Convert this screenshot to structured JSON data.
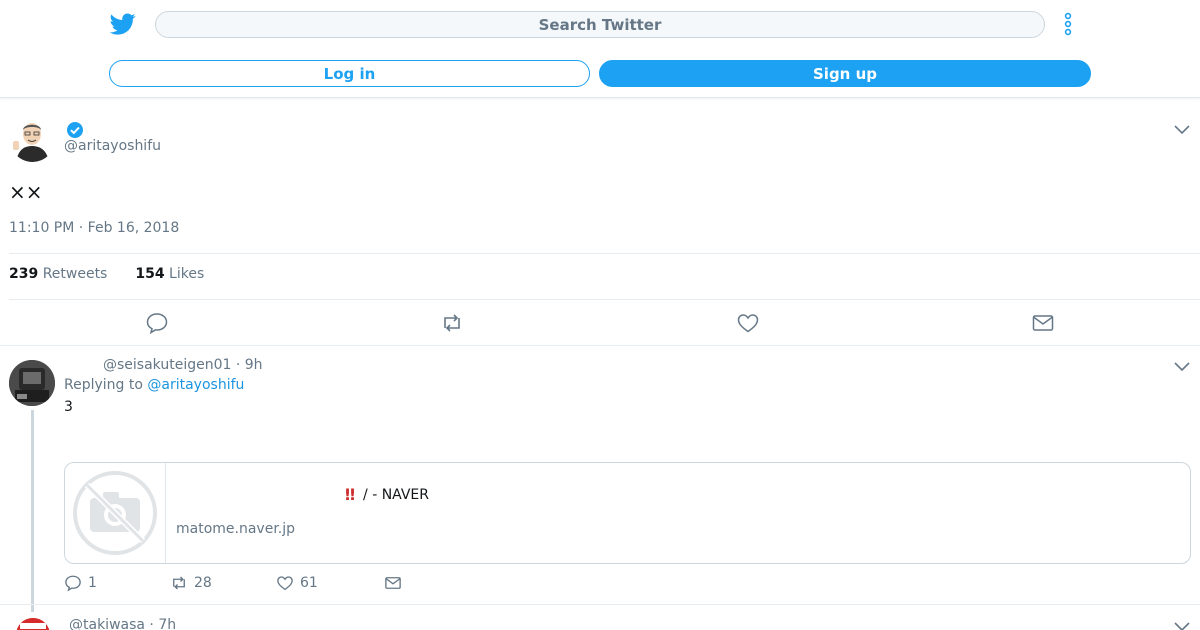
{
  "header": {
    "search_placeholder": "Search Twitter",
    "login_label": "Log in",
    "signup_label": "Sign up"
  },
  "tweet": {
    "handle": "@aritayoshifu",
    "text": "××",
    "timestamp": "11:10 PM · Feb 16, 2018",
    "retweets_count": "239",
    "retweets_label": "Retweets",
    "likes_count": "154",
    "likes_label": "Likes"
  },
  "reply": {
    "handle_time": "@seisakuteigen01 · 9h",
    "replying_prefix": "Replying to",
    "replying_to": "@aritayoshifu",
    "text": "3",
    "card": {
      "title_mark": "‼",
      "title": "/ - NAVER",
      "domain": "matome.naver.jp"
    },
    "reply_count": "1",
    "retweet_count": "28",
    "like_count": "61"
  },
  "next_reply": {
    "handle_time": "@takiwasa · 7h"
  },
  "colors": {
    "brand": "#1da1f2",
    "link": "#1b95e0",
    "muted": "#657786",
    "border": "#e6ecf0"
  }
}
